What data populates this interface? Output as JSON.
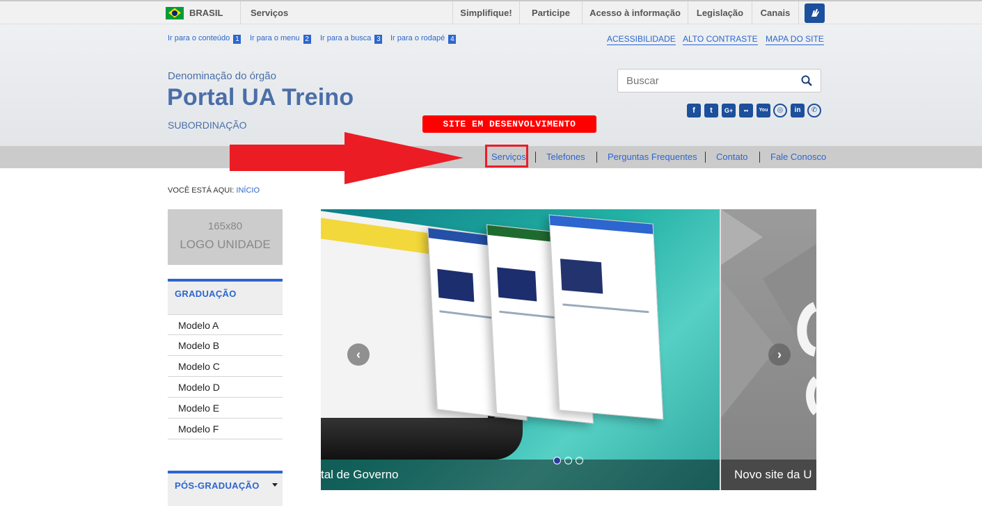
{
  "barra": {
    "brasil": "BRASIL",
    "servicos": "Serviços",
    "links": [
      "Simplifique!",
      "Participe",
      "Acesso à informação",
      "Legislação",
      "Canais"
    ]
  },
  "header": {
    "access_links": [
      {
        "label": "Ir para o conteúdo",
        "num": "1"
      },
      {
        "label": "Ir para o menu",
        "num": "2"
      },
      {
        "label": "Ir para a busca",
        "num": "3"
      },
      {
        "label": "Ir para o rodapé",
        "num": "4"
      }
    ],
    "top_links": [
      "ACESSIBILIDADE",
      "ALTO CONTRASTE",
      "MAPA DO SITE"
    ],
    "denominacao": "Denominação do órgão",
    "title": "Portal UA Treino",
    "subordinacao": "SUBORDINAÇÃO",
    "search_placeholder": "Buscar",
    "dev_badge": "SITE EM DESENVOLVIMENTO",
    "social_icons": [
      "facebook-icon",
      "twitter-icon",
      "google-plus-icon",
      "flickr-icon",
      "youtube-icon",
      "instagram-icon",
      "linkedin-icon",
      "whatsapp-icon"
    ]
  },
  "nav": {
    "items": [
      "Serviços",
      "Telefones",
      "Perguntas Frequentes",
      "Contato",
      "Fale Conosco"
    ]
  },
  "breadcrumb": {
    "prefix": "VOCÊ ESTÁ AQUI:",
    "current": "INÍCIO"
  },
  "sidebar": {
    "logo_line1": "165x80",
    "logo_line2": "LOGO UNIDADE",
    "graduacao": {
      "title": "GRADUAÇÃO",
      "items": [
        "Modelo A",
        "Modelo B",
        "Modelo C",
        "Modelo D",
        "Modelo E",
        "Modelo F"
      ]
    },
    "pos_graduacao": {
      "title": "PÓS-GRADUAÇÃO"
    }
  },
  "carousel": {
    "caption1": "tal de Governo",
    "caption2": "Novo site da U",
    "slide_count": 3,
    "active_slide": 0
  },
  "colors": {
    "link_blue": "#2c66ce",
    "title_blue": "#4a6ea8",
    "highlight_red": "#e81e2a",
    "badge_red": "#ff0000"
  }
}
